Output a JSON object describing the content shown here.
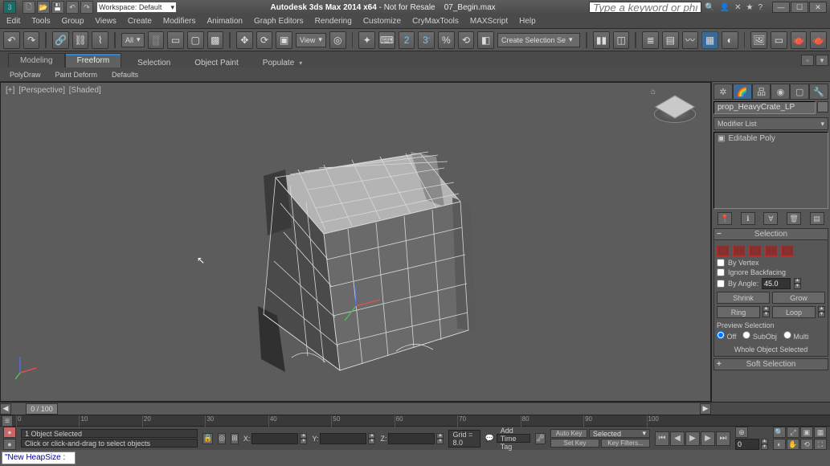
{
  "titlebar": {
    "workspace_dd": "Workspace: Default",
    "app": "Autodesk 3ds Max 2014 x64",
    "modifier": "Not for Resale",
    "file": "07_Begin.max",
    "search_placeholder": "Type a keyword or phrase"
  },
  "menus": [
    "Edit",
    "Tools",
    "Group",
    "Views",
    "Create",
    "Modifiers",
    "Animation",
    "Graph Editors",
    "Rendering",
    "Customize",
    "CryMaxTools",
    "MAXScript",
    "Help"
  ],
  "toolbar": {
    "sel_filter": "All",
    "view_dd": "View",
    "named_sel": "Create Selection Se"
  },
  "ribbon": {
    "tabs": [
      "Modeling",
      "Freeform",
      "Selection",
      "Object Paint",
      "Populate"
    ],
    "sub": [
      "PolyDraw",
      "Paint Deform",
      "Defaults"
    ]
  },
  "viewport_label": {
    "cam": "[+]",
    "view": "[Perspective]",
    "shade": "[Shaded]"
  },
  "cp": {
    "obj_name": "prop_HeavyCrate_LP",
    "mod_list": "Modifier List",
    "stack_item": "Editable Poly",
    "rollouts": {
      "selection": "Selection",
      "softsel": "Soft Selection"
    },
    "by_vertex": "By Vertex",
    "ignore_bf": "Ignore Backfacing",
    "by_angle": "By Angle:",
    "by_angle_val": "45.0",
    "shrink": "Shrink",
    "grow": "Grow",
    "ring": "Ring",
    "loop": "Loop",
    "preview": "Preview Selection",
    "off": "Off",
    "subobj": "SubObj",
    "multi": "Multi",
    "status": "Whole Object Selected"
  },
  "time": {
    "frame": "0 / 100"
  },
  "status": {
    "obj_sel": "1 Object Selected",
    "hint": "Click or click-and-drag to select objects",
    "x": "X:",
    "y": "Y:",
    "z": "Z:",
    "grid": "Grid = 8.0",
    "add_tag": "Add Time Tag",
    "auto_key": "Auto Key",
    "key_dd": "Selected",
    "set_key": "Set Key",
    "key_filters": "Key Filters...",
    "heap": "\"New HeapSize :"
  }
}
